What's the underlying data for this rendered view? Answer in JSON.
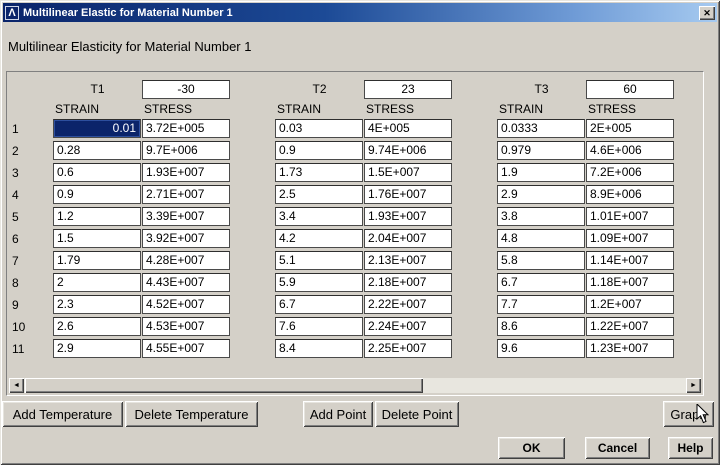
{
  "window": {
    "title": "Multilinear Elastic for Material Number 1"
  },
  "header": {
    "title": "Multilinear Elasticity for Material Number 1"
  },
  "icons": {
    "app": "Λ",
    "close": "✕",
    "scroll_left": "◄",
    "scroll_right": "►"
  },
  "table": {
    "strain_header": "STRAIN",
    "stress_header": "STRESS",
    "row_numbers": [
      "1",
      "2",
      "3",
      "4",
      "5",
      "6",
      "7",
      "8",
      "9",
      "10",
      "11"
    ],
    "columns": [
      {
        "label": "T1",
        "temperature": "-30",
        "strain": [
          "0.01",
          "0.28",
          "0.6",
          "0.9",
          "1.2",
          "1.5",
          "1.79",
          "2",
          "2.3",
          "2.6",
          "2.9"
        ],
        "stress": [
          "3.72E+005",
          "9.7E+006",
          "1.93E+007",
          "2.71E+007",
          "3.39E+007",
          "3.92E+007",
          "4.28E+007",
          "4.43E+007",
          "4.52E+007",
          "4.53E+007",
          "4.55E+007"
        ]
      },
      {
        "label": "T2",
        "temperature": "23",
        "strain": [
          "0.03",
          "0.9",
          "1.73",
          "2.5",
          "3.4",
          "4.2",
          "5.1",
          "5.9",
          "6.7",
          "7.6",
          "8.4"
        ],
        "stress": [
          "4E+005",
          "9.74E+006",
          "1.5E+007",
          "1.76E+007",
          "1.93E+007",
          "2.04E+007",
          "2.13E+007",
          "2.18E+007",
          "2.22E+007",
          "2.24E+007",
          "2.25E+007"
        ]
      },
      {
        "label": "T3",
        "temperature": "60",
        "strain": [
          "0.0333",
          "0.979",
          "1.9",
          "2.9",
          "3.8",
          "4.8",
          "5.8",
          "6.7",
          "7.7",
          "8.6",
          "9.6"
        ],
        "stress": [
          "2E+005",
          "4.6E+006",
          "7.2E+006",
          "8.9E+006",
          "1.01E+007",
          "1.09E+007",
          "1.14E+007",
          "1.18E+007",
          "1.2E+007",
          "1.22E+007",
          "1.23E+007"
        ]
      }
    ],
    "selected_cell": {
      "row": 1,
      "column": "T1",
      "field": "strain",
      "value": "0.01"
    }
  },
  "action_buttons": {
    "add_temperature": "Add Temperature",
    "delete_temperature": "Delete Temperature",
    "add_point": "Add Point",
    "delete_point": "Delete Point",
    "graph": "Graph"
  },
  "dialog_buttons": {
    "ok": "OK",
    "cancel": "Cancel",
    "help": "Help"
  },
  "colors": {
    "dialog_bg": "#d4d0c8",
    "titlebar_start": "#0a246a",
    "titlebar_end": "#a6caf0",
    "selected_cell_bg": "#0b246a",
    "selected_cell_text": "#ffffff"
  }
}
